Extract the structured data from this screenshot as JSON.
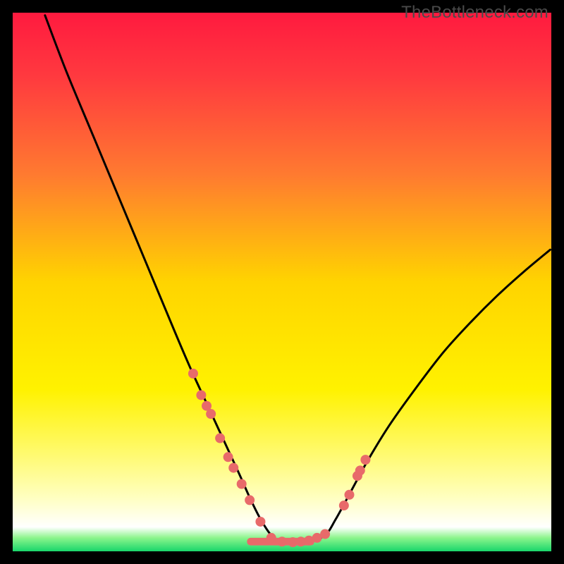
{
  "watermark": "TheBottleneck.com",
  "chart_data": {
    "type": "line",
    "title": "",
    "xlabel": "",
    "ylabel": "",
    "xlim": [
      0,
      100
    ],
    "ylim": [
      0,
      100
    ],
    "background_gradient": {
      "stops": [
        {
          "offset": 0.0,
          "color": "#ff1a3f"
        },
        {
          "offset": 0.12,
          "color": "#ff3a3f"
        },
        {
          "offset": 0.3,
          "color": "#ff7a30"
        },
        {
          "offset": 0.5,
          "color": "#ffd400"
        },
        {
          "offset": 0.7,
          "color": "#fff200"
        },
        {
          "offset": 0.82,
          "color": "#fffa70"
        },
        {
          "offset": 0.9,
          "color": "#ffffc0"
        },
        {
          "offset": 0.955,
          "color": "#ffffff"
        },
        {
          "offset": 0.975,
          "color": "#8cf58c"
        },
        {
          "offset": 1.0,
          "color": "#19d66b"
        }
      ]
    },
    "series": [
      {
        "name": "bottleneck-curve",
        "x": [
          6.0,
          10.0,
          15.0,
          20.0,
          25.0,
          30.0,
          33.0,
          36.0,
          39.0,
          42.0,
          44.0,
          46.0,
          48.0,
          50.0,
          52.0,
          55.0,
          58.0,
          60.0,
          63.0,
          66.0,
          70.0,
          75.0,
          80.0,
          85.0,
          90.0,
          95.0,
          99.8
        ],
        "y": [
          99.5,
          89.0,
          77.0,
          65.0,
          53.0,
          41.0,
          34.0,
          27.5,
          21.0,
          14.5,
          10.0,
          6.0,
          3.0,
          1.8,
          1.7,
          1.8,
          3.0,
          6.0,
          11.5,
          17.0,
          23.5,
          30.5,
          37.0,
          42.5,
          47.5,
          52.0,
          56.0
        ]
      }
    ],
    "points": {
      "name": "sample-dots",
      "color": "#e86a6a",
      "x": [
        33.5,
        35.0,
        36.0,
        36.8,
        38.5,
        40.0,
        41.0,
        42.5,
        44.0,
        46.0,
        48.0,
        50.0,
        52.0,
        53.5,
        55.0,
        56.5,
        58.0,
        61.5,
        62.5,
        64.0,
        64.5,
        65.5
      ],
      "y": [
        33.0,
        29.0,
        27.0,
        25.5,
        21.0,
        17.5,
        15.5,
        12.5,
        9.5,
        5.5,
        2.5,
        1.8,
        1.7,
        1.8,
        2.0,
        2.5,
        3.2,
        8.5,
        10.5,
        14.0,
        15.0,
        17.0
      ]
    },
    "bottom_bar": {
      "name": "optimal-range",
      "color": "#e86a6a",
      "x_start": 43.5,
      "x_end": 56.0,
      "y": 1.8,
      "height": 1.4
    }
  }
}
